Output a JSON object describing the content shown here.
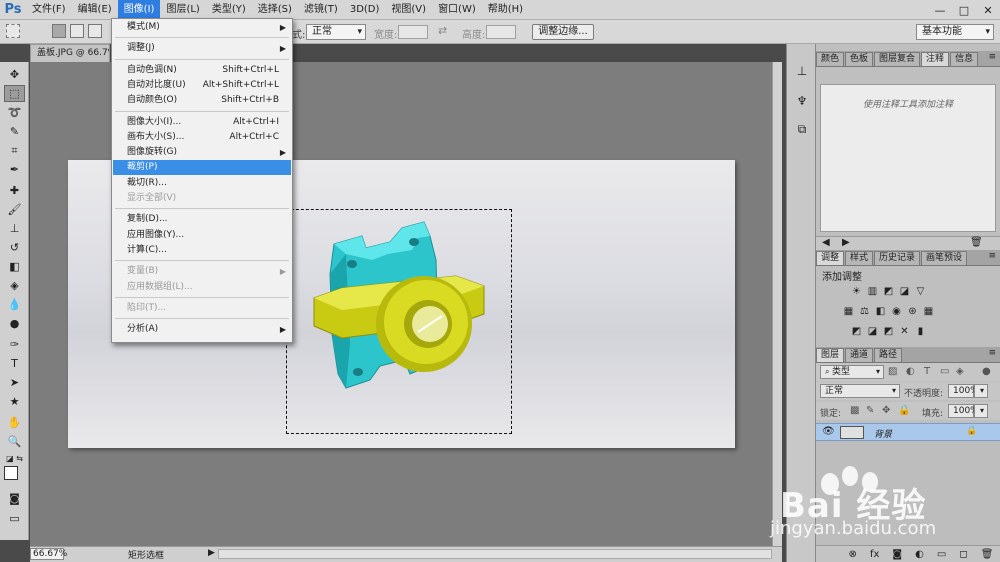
{
  "app": {
    "logo": "Ps"
  },
  "menubar": {
    "items": [
      "文件(F)",
      "编辑(E)",
      "图像(I)",
      "图层(L)",
      "类型(Y)",
      "选择(S)",
      "滤镜(T)",
      "3D(D)",
      "视图(V)",
      "窗口(W)",
      "帮助(H)"
    ],
    "active_index": 2,
    "window_controls": [
      "—",
      "□",
      "✕"
    ]
  },
  "options_bar": {
    "style_label_fragment": "式:",
    "style_value": "正常",
    "width_label": "宽度:",
    "height_label": "高度:",
    "refine_edge_button": "调整边缘...",
    "workspace_value": "基本功能"
  },
  "document": {
    "tab_title": "盖板.JPG @ 66.7%",
    "zoom": "66.67%",
    "status_text": "矩形选框"
  },
  "image_menu": {
    "sections": [
      [
        {
          "label": "模式(M)",
          "shortcut": "",
          "submenu": true,
          "disabled": false
        }
      ],
      [
        {
          "label": "调整(J)",
          "shortcut": "",
          "submenu": true,
          "disabled": false
        }
      ],
      [
        {
          "label": "自动色调(N)",
          "shortcut": "Shift+Ctrl+L",
          "submenu": false,
          "disabled": false
        },
        {
          "label": "自动对比度(U)",
          "shortcut": "Alt+Shift+Ctrl+L",
          "submenu": false,
          "disabled": false
        },
        {
          "label": "自动颜色(O)",
          "shortcut": "Shift+Ctrl+B",
          "submenu": false,
          "disabled": false
        }
      ],
      [
        {
          "label": "图像大小(I)...",
          "shortcut": "Alt+Ctrl+I",
          "submenu": false,
          "disabled": false
        },
        {
          "label": "画布大小(S)...",
          "shortcut": "Alt+Ctrl+C",
          "submenu": false,
          "disabled": false
        },
        {
          "label": "图像旋转(G)",
          "shortcut": "",
          "submenu": true,
          "disabled": false
        },
        {
          "label": "裁剪(P)",
          "shortcut": "",
          "submenu": false,
          "disabled": false,
          "highlighted": true
        },
        {
          "label": "裁切(R)...",
          "shortcut": "",
          "submenu": false,
          "disabled": false
        },
        {
          "label": "显示全部(V)",
          "shortcut": "",
          "submenu": false,
          "disabled": true
        }
      ],
      [
        {
          "label": "复制(D)...",
          "shortcut": "",
          "submenu": false,
          "disabled": false
        },
        {
          "label": "应用图像(Y)...",
          "shortcut": "",
          "submenu": false,
          "disabled": false
        },
        {
          "label": "计算(C)...",
          "shortcut": "",
          "submenu": false,
          "disabled": false
        }
      ],
      [
        {
          "label": "变量(B)",
          "shortcut": "",
          "submenu": true,
          "disabled": true
        },
        {
          "label": "应用数据组(L)...",
          "shortcut": "",
          "submenu": false,
          "disabled": true
        }
      ],
      [
        {
          "label": "陷印(T)...",
          "shortcut": "",
          "submenu": false,
          "disabled": true
        }
      ],
      [
        {
          "label": "分析(A)",
          "shortcut": "",
          "submenu": true,
          "disabled": false
        }
      ]
    ]
  },
  "panels": {
    "top_tabs": [
      "颜色",
      "色板",
      "图层复合",
      "注释",
      "信息"
    ],
    "top_active": 3,
    "notes_hint": "使用注释工具添加注释",
    "adjust_tabs": [
      "调整",
      "样式",
      "历史记录",
      "画笔预设"
    ],
    "adjust_active": 0,
    "adjust_title": "添加调整",
    "layers_tabs": [
      "图层",
      "通道",
      "路径"
    ],
    "layers_active": 0,
    "filter_label": "类型",
    "blend_mode": "正常",
    "opacity_label": "不透明度:",
    "opacity_value": "100%",
    "lock_label": "锁定:",
    "fill_label": "填充:",
    "fill_value": "100%",
    "layer_name": "背景"
  },
  "watermark": {
    "brand": "Bai  经验",
    "url": "jingyan.baidu.com"
  },
  "colors": {
    "accent": "#3a8ee6",
    "part_cyan": "#2fd1d6",
    "part_yellow": "#d8da1a"
  }
}
